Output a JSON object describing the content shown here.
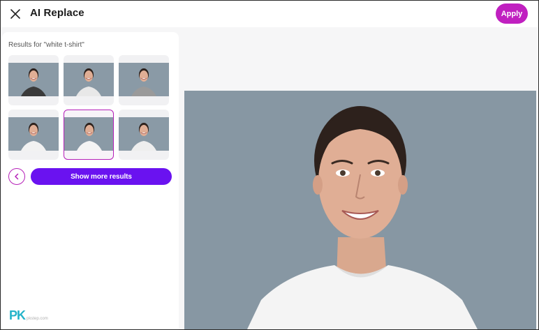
{
  "header": {
    "title": "AI Replace",
    "apply_label": "Apply",
    "close_icon": "close-icon"
  },
  "results": {
    "label": "Results for \"white t-shirt\"",
    "selected_index": 4,
    "thumbnails": [
      {
        "shirt": "#3a3a3a",
        "pattern": "patterned-dark"
      },
      {
        "shirt": "#e8e8e8",
        "pattern": "patterned-light"
      },
      {
        "shirt": "#9a9a9a",
        "pattern": "patterned-gray"
      },
      {
        "shirt": "#f2f2f2",
        "pattern": "plain-white"
      },
      {
        "shirt": "#f4f4f4",
        "pattern": "plain-white"
      },
      {
        "shirt": "#eeeeee",
        "pattern": "white-logo"
      }
    ],
    "prev_icon": "chevron-left-icon",
    "show_more_label": "Show more results"
  },
  "colors": {
    "accent": "#c020c0",
    "button_primary": "#6a12f0",
    "photo_background": "#8a9aa6"
  },
  "watermark": {
    "text": "PK",
    "subtext": "pkstep.com"
  }
}
